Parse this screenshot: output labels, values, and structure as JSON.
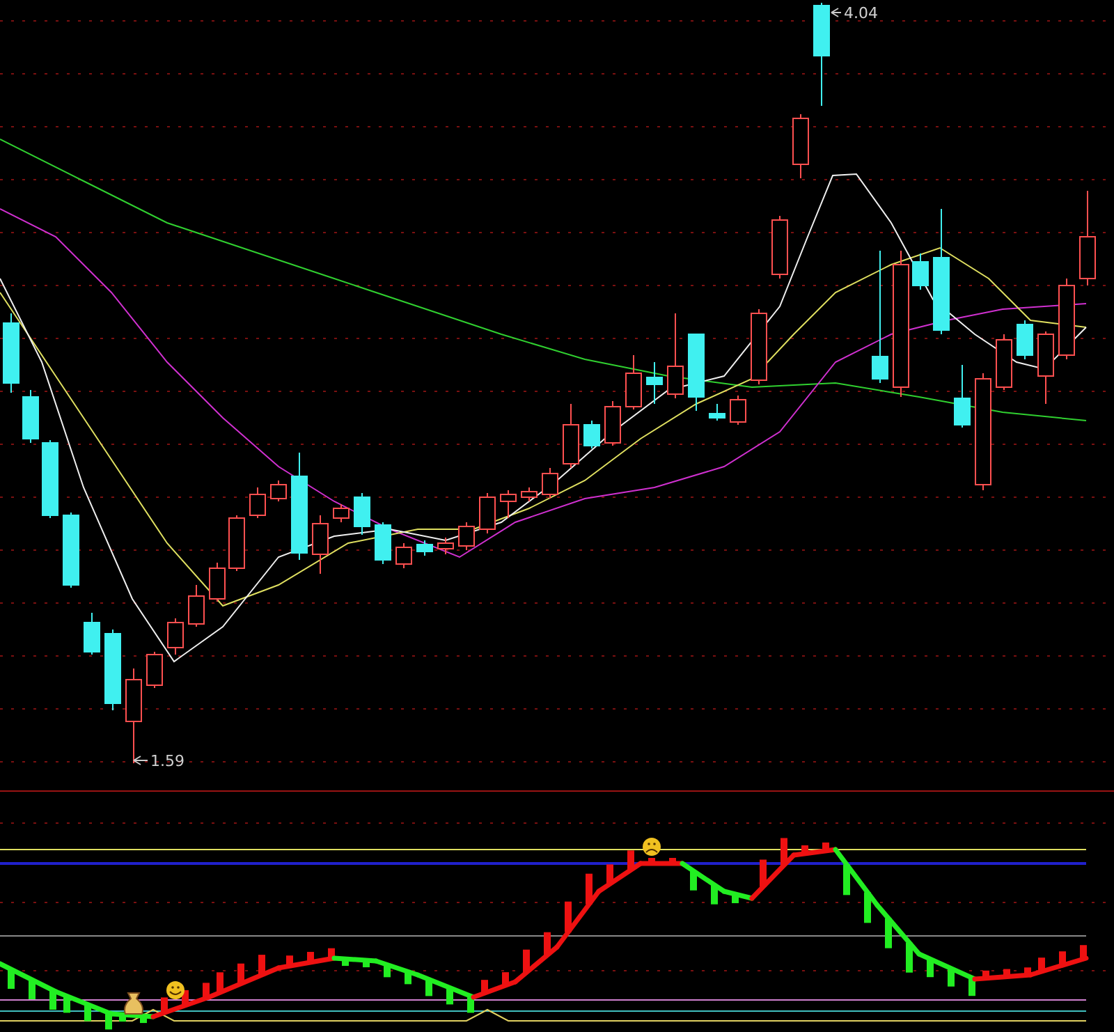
{
  "price_chart": {
    "high_label": "4.04",
    "low_label": "1.59"
  }
}
